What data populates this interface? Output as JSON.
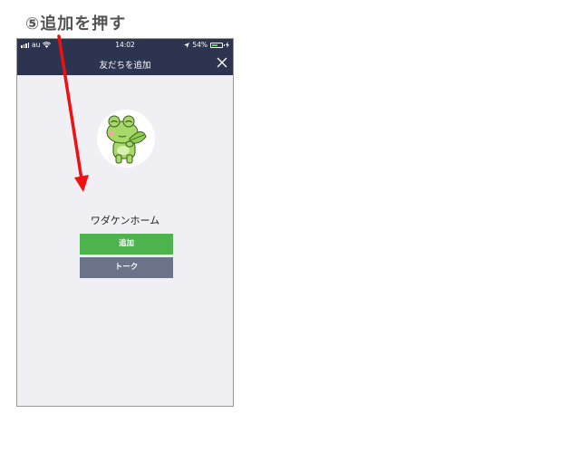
{
  "annotation": {
    "step_label": "⑤追加を押す",
    "arrow_color": "#ee1111"
  },
  "status_bar": {
    "carrier": "au",
    "time": "14:02",
    "battery": "54%"
  },
  "nav": {
    "title": "友だちを追加",
    "close_icon": "close-icon"
  },
  "profile": {
    "name": "ワダケンホーム",
    "avatar_icon": "frog-character"
  },
  "actions": {
    "add_label": "追加",
    "talk_label": "トーク",
    "add_color": "#4db34d",
    "talk_color": "#6a7388"
  },
  "colors": {
    "header_bg": "#2c3450",
    "screen_bg": "#efeff4"
  }
}
